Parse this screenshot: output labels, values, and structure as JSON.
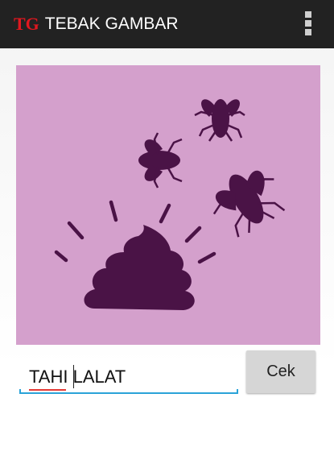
{
  "app": {
    "logo": "TG",
    "title": "TEBAK GAMBAR",
    "overflow_icon": "overflow-menu-icon"
  },
  "puzzle": {
    "image": "poop-with-flies-illustration",
    "background_color": "#d4a0cc",
    "figure_color": "#4a1346"
  },
  "answer": {
    "value": "TAHI LALAT",
    "placeholder": ""
  },
  "check_button": {
    "label": "Cek"
  },
  "colors": {
    "appbar": "#222222",
    "logo": "#e0171f",
    "field_underline": "#2aa3d8",
    "spellcheck": "#e53935"
  }
}
